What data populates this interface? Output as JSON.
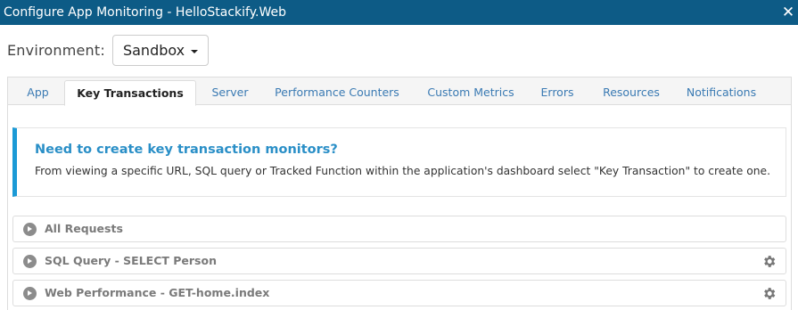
{
  "window": {
    "title": "Configure App Monitoring - HelloStackify.Web",
    "close_icon": "close-icon"
  },
  "environment": {
    "label": "Environment:",
    "selected": "Sandbox"
  },
  "tabs": [
    {
      "label": "App"
    },
    {
      "label": "Key Transactions",
      "active": true
    },
    {
      "label": "Server"
    },
    {
      "label": "Performance Counters"
    },
    {
      "label": "Custom Metrics"
    },
    {
      "label": "Errors"
    },
    {
      "label": "Resources"
    },
    {
      "label": "Notifications"
    }
  ],
  "callout": {
    "title": "Need to create key transaction monitors?",
    "text": "From viewing a specific URL, SQL query or Tracked Function within the application's dashboard select \"Key Transaction\" to create one."
  },
  "transactions": [
    {
      "label": "All Requests",
      "has_settings": false
    },
    {
      "label": "SQL Query - SELECT Person",
      "has_settings": true
    },
    {
      "label": "Web Performance - GET-home.index",
      "has_settings": true
    }
  ],
  "colors": {
    "titlebar": "#0d5b86",
    "accent": "#1b9ad6",
    "link": "#3a7ab3"
  }
}
